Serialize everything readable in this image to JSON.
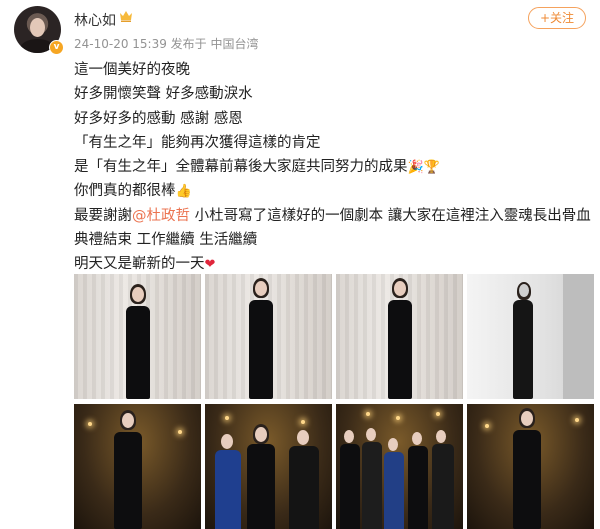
{
  "user": {
    "name": "林心如",
    "meta": "24-10-20 15:39 发布于 中国台湾",
    "follow_label": "+关注"
  },
  "post": {
    "lines": [
      "這一個美好的夜晚",
      "好多開懷笑聲   好多感動淚水",
      "好多好多的感動  感謝  感恩",
      "「有生之年」能夠再次獲得這樣的肯定",
      "是「有生之年」全體幕前幕後大家庭共同努力的成果",
      "你們真的都很棒",
      "最要謝謝",
      "@杜政哲",
      " 小杜哥寫了這樣好的一個劇本 讓大家在這裡注入靈魂長出骨血",
      "典禮結束  工作繼續  生活繼續",
      "明天又是嶄新的一天"
    ],
    "emojis": {
      "celebrate": "🎉🏆",
      "thumbs": "👍",
      "heart": "❤"
    }
  },
  "colors": {
    "accent": "#ef8a34",
    "mention": "#eb7350",
    "meta_gray": "#939393"
  },
  "photos": [
    {
      "scene": "red-carpet"
    },
    {
      "scene": "red-carpet"
    },
    {
      "scene": "red-carpet"
    },
    {
      "scene": "black-and-white"
    },
    {
      "scene": "stage"
    },
    {
      "scene": "stage-group"
    },
    {
      "scene": "stage-group"
    },
    {
      "scene": "stage"
    }
  ]
}
